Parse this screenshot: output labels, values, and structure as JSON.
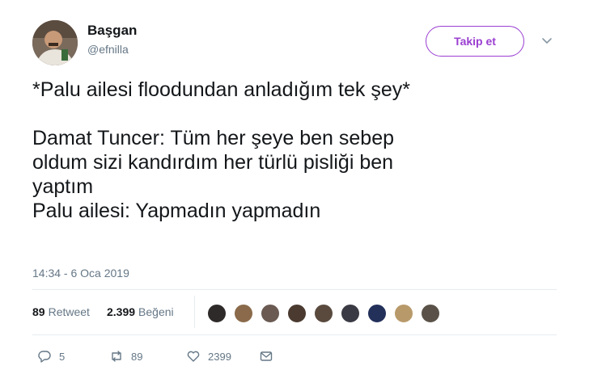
{
  "user": {
    "display_name": "Başgan",
    "handle": "@efnilla",
    "follow_label": "Takip et"
  },
  "tweet": {
    "text": "*Palu ailesi floodundan anladığım tek şey*\n\nDamat Tuncer: Tüm her şeye ben sebep\noldum sizi kandırdım her türlü pisliği ben\nyaptım\nPalu ailesi: Yapmadın yapmadın",
    "timestamp": "14:34 - 6 Oca 2019"
  },
  "stats": {
    "retweets_count": "89",
    "retweets_label": "Retweet",
    "likes_count": "2.399",
    "likes_label": "Beğeni"
  },
  "actions": {
    "reply_count": "5",
    "retweet_count": "89",
    "like_count": "2399"
  },
  "colors": {
    "accent": "#9b3fd1",
    "muted": "#657786",
    "text": "#14171a"
  },
  "icons": [
    "chevron-down-icon",
    "reply-icon",
    "retweet-icon",
    "like-icon",
    "direct-message-icon"
  ],
  "liker_avatars": [
    {
      "color": "#2f2a2a"
    },
    {
      "color": "#8a6a4a"
    },
    {
      "color": "#6a5a52"
    },
    {
      "color": "#4a3a30"
    },
    {
      "color": "#5a4a3e"
    },
    {
      "color": "#3a3a44"
    },
    {
      "color": "#23305a"
    },
    {
      "color": "#b89a6a"
    },
    {
      "color": "#5a5248"
    }
  ]
}
